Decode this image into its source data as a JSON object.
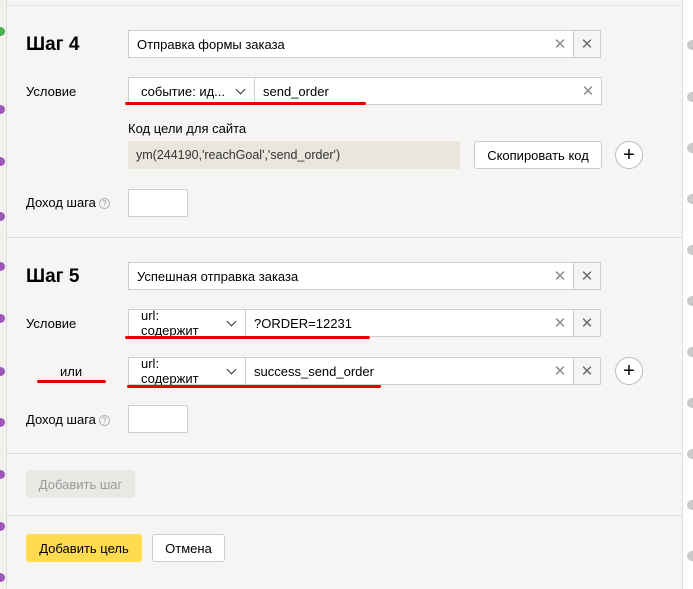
{
  "step4": {
    "title": "Шаг 4",
    "name_value": "Отправка формы заказа",
    "condition_label": "Условие",
    "condition_type": "событие: ид...",
    "condition_value": "send_order",
    "code_label": "Код цели для сайта",
    "code_value": "ym(244190,'reachGoal','send_order')",
    "copy_button": "Скопировать код",
    "revenue_label": "Доход шага"
  },
  "step5": {
    "title": "Шаг 5",
    "name_value": "Успешная отправка заказа",
    "condition_label": "Условие",
    "condition_type": "url: содержит",
    "condition_value": "?ORDER=12231",
    "or_label": "или",
    "or_condition_type": "url: содержит",
    "or_condition_value": "success_send_order",
    "revenue_label": "Доход шага"
  },
  "actions": {
    "add_step": "Добавить шаг",
    "add_goal": "Добавить цель",
    "cancel": "Отмена"
  },
  "glyphs": {
    "clear": "✕",
    "remove": "✕",
    "plus": "+",
    "hint": "?"
  },
  "colors": {
    "primary_button": "#ffdb4d",
    "annotation": "#e60000",
    "modal_bg": "#f6f5f3"
  }
}
